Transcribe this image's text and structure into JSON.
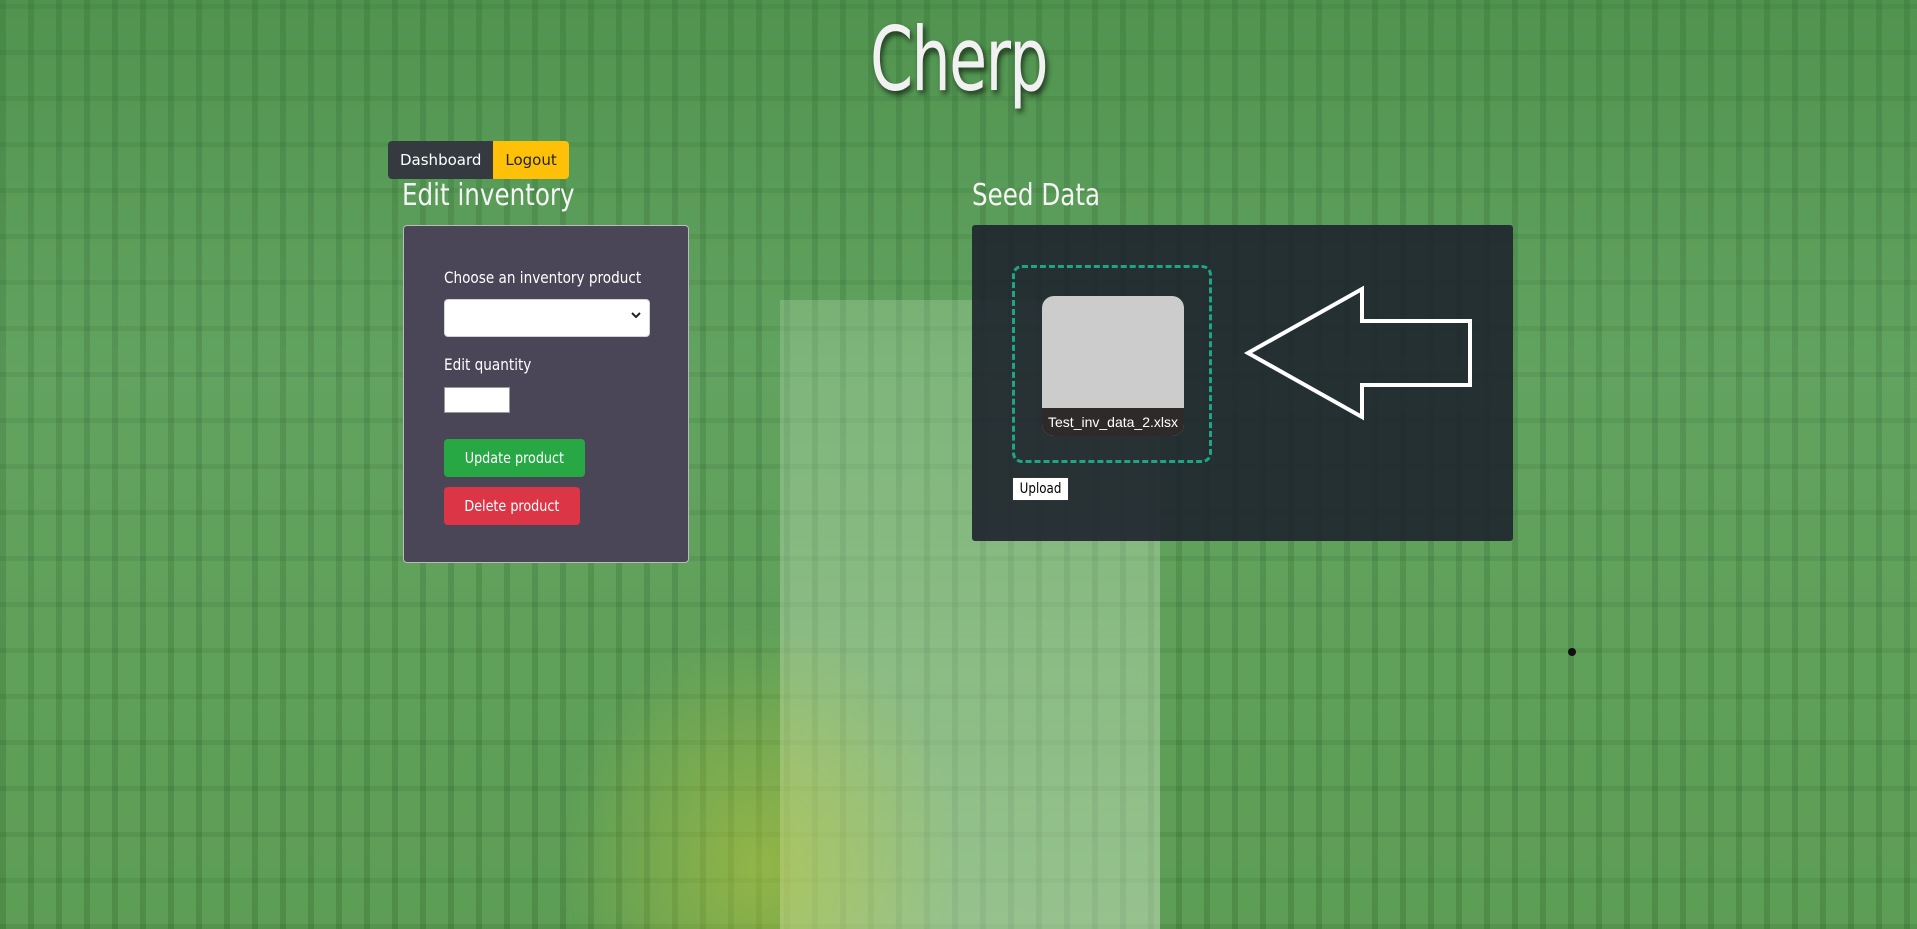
{
  "app": {
    "title": "Cherp"
  },
  "nav": {
    "dashboard_label": "Dashboard",
    "logout_label": "Logout"
  },
  "edit_inventory": {
    "heading": "Edit inventory",
    "choose_label": "Choose an inventory product",
    "selected_product": "",
    "quantity_label": "Edit quantity",
    "quantity_value": "",
    "update_label": "Update product",
    "delete_label": "Delete product"
  },
  "seed_data": {
    "heading": "Seed Data",
    "file_name": "Test_inv_data_2.xlsx",
    "upload_label": "Upload"
  },
  "icons": {
    "select_chevron": "chevron-down-icon",
    "drop_arrow": "arrow-left-icon"
  },
  "colors": {
    "dashboard_bg": "#343a40",
    "logout_bg": "#ffc107",
    "update_bg": "#28a745",
    "delete_bg": "#dc3545",
    "dropzone_border": "#1fa584",
    "edit_card_bg": "#4a4658",
    "seed_card_bg": "#1e242e"
  }
}
